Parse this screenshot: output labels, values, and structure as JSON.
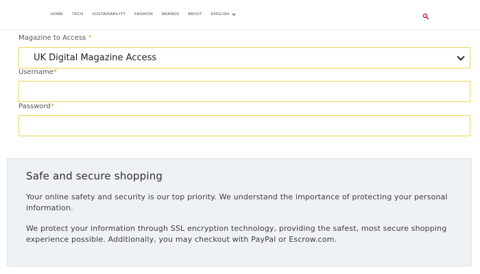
{
  "nav": {
    "items": [
      "HOME",
      "TECH",
      "SUSTAINABILITY",
      "FASHION",
      "BRANDS",
      "ABOUT"
    ],
    "language": "ENGLISH",
    "search_icon": "search-icon",
    "accent_color": "#c2185b"
  },
  "form": {
    "magazine_label": "Magazine to Access",
    "magazine_selected": "UK Digital Magazine Access",
    "username_label": "Username",
    "username_value": "",
    "password_label": "Password",
    "password_value": "",
    "required_marker": "*",
    "field_border_color": "#ecd650"
  },
  "secure": {
    "title": "Safe and secure shopping",
    "paragraph1": "Your online safety and security is our top priority. We understand the importance of protecting your personal information.",
    "paragraph2": "We protect your information through SSL encryption technology, providing the safest, most secure shopping experience possible. Additionally, you may checkout with PayPal or Escrow.com."
  }
}
